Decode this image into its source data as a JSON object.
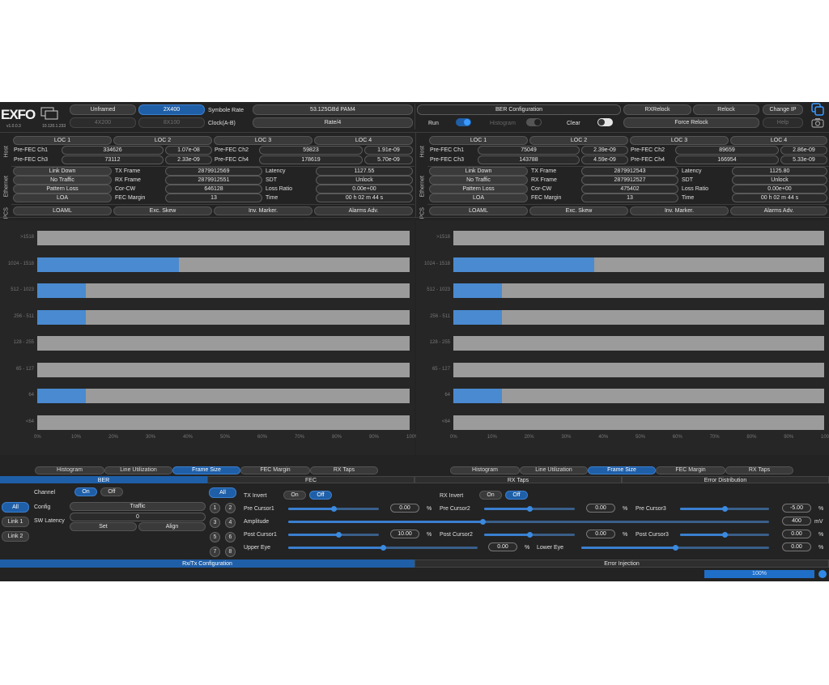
{
  "brand": {
    "logo": "EXFO",
    "version": "v1.0.0.3",
    "ip": "10.120.1.233"
  },
  "top": {
    "mode_unframed": "Unframed",
    "mode_2x400": "2X400",
    "mode_4x200": "4X200",
    "mode_8x100": "8X100",
    "symbol_rate_label": "Symbole Rate",
    "symbol_rate_value": "53.125GBd PAM4",
    "clock_label": "Clock(A-B)",
    "clock_value": "Rate/4",
    "ber_config": "BER Configuration",
    "run_label": "Run",
    "histogram_label": "Histogram",
    "clear_label": "Clear",
    "rxrelock": "RXRelock",
    "relock": "Relock",
    "force_relock": "Force Relock",
    "change_ip": "Change IP",
    "help": "Help"
  },
  "side_labels": {
    "host": "Host",
    "ethernet": "Ethernet",
    "pcs": "PCS"
  },
  "panels": [
    {
      "loc": [
        "LOC 1",
        "LOC 2",
        "LOC 3",
        "LOC 4"
      ],
      "pre_fec": {
        "ch1_label": "Pre-FEC Ch1",
        "ch1_count": "334626",
        "ch1_rate": "1.07e-08",
        "ch2_label": "Pre-FEC Ch2",
        "ch2_count": "59823",
        "ch2_rate": "1.91e-09",
        "ch3_label": "Pre-FEC Ch3",
        "ch3_count": "73112",
        "ch3_rate": "2.33e-09",
        "ch4_label": "Pre-FEC Ch4",
        "ch4_count": "178619",
        "ch4_rate": "5.70e-09"
      },
      "eth": {
        "link_down": "Link Down",
        "no_traffic": "No Traffic",
        "pattern_loss": "Pattern Loss",
        "loa": "LOA",
        "tx_frame_label": "TX Frame",
        "tx_frame": "2879912569",
        "rx_frame_label": "RX Frame",
        "rx_frame": "2879912551",
        "corcw_label": "Cor-CW",
        "corcw": "646128",
        "fec_margin_label": "FEC Margin",
        "fec_margin": "13",
        "latency_label": "Latency",
        "latency": "1127.55",
        "sdt_label": "SDT",
        "sdt": "Unlock",
        "loss_ratio_label": "Loss Ratio",
        "loss_ratio": "0.00e+00",
        "time_label": "Time",
        "time": "00 h 02 m 44 s"
      },
      "pcs": [
        "LOAML",
        "Exc. Skew",
        "Inv. Marker.",
        "Alarms Adv."
      ],
      "tabs": [
        "Histogram",
        "Line Utilization",
        "Frame Size",
        "FEC Margin",
        "RX Taps"
      ]
    },
    {
      "loc": [
        "LOC 1",
        "LOC 2",
        "LOC 3",
        "LOC 4"
      ],
      "pre_fec": {
        "ch1_label": "Pre-FEC Ch1",
        "ch1_count": "75049",
        "ch1_rate": "2.39e-09",
        "ch2_label": "Pre-FEC Ch2",
        "ch2_count": "89659",
        "ch2_rate": "2.86e-09",
        "ch3_label": "Pre-FEC Ch3",
        "ch3_count": "143788",
        "ch3_rate": "4.59e-09",
        "ch4_label": "Pre-FEC Ch4",
        "ch4_count": "166954",
        "ch4_rate": "5.33e-09"
      },
      "eth": {
        "link_down": "Link Down",
        "no_traffic": "No Traffic",
        "pattern_loss": "Pattern Loss",
        "loa": "LOA",
        "tx_frame_label": "TX Frame",
        "tx_frame": "2879912543",
        "rx_frame_label": "RX Frame",
        "rx_frame": "2879912527",
        "corcw_label": "Cor-CW",
        "corcw": "475402",
        "fec_margin_label": "FEC Margin",
        "fec_margin": "13",
        "latency_label": "Latency",
        "latency": "1125.80",
        "sdt_label": "SDT",
        "sdt": "Unlock",
        "loss_ratio_label": "Loss Ratio",
        "loss_ratio": "0.00e+00",
        "time_label": "Time",
        "time": "00 h 02 m 44 s"
      },
      "pcs": [
        "LOAML",
        "Exc. Skew",
        "Inv. Marker.",
        "Alarms Adv."
      ],
      "tabs": [
        "Histogram",
        "Line Utilization",
        "Frame Size",
        "FEC Margin",
        "RX Taps"
      ]
    }
  ],
  "chart_data": [
    {
      "type": "bar",
      "orientation": "horizontal",
      "categories": [
        ">1518",
        "1024 - 1518",
        "512 - 1023",
        "256 - 511",
        "128 - 255",
        "65 - 127",
        "64",
        "<64"
      ],
      "values": [
        0,
        38,
        13,
        13,
        0,
        0,
        13,
        0
      ],
      "xlim": [
        0,
        100
      ],
      "xticks": [
        "0%",
        "10%",
        "20%",
        "30%",
        "40%",
        "50%",
        "60%",
        "70%",
        "80%",
        "90%",
        "100%"
      ]
    },
    {
      "type": "bar",
      "orientation": "horizontal",
      "categories": [
        ">1518",
        "1024 - 1518",
        "512 - 1023",
        "256 - 511",
        "128 - 255",
        "65 - 127",
        "64",
        "<64"
      ],
      "values": [
        0,
        38,
        13,
        13,
        0,
        0,
        13,
        0
      ],
      "xlim": [
        0,
        100
      ],
      "xticks": [
        "0%",
        "10%",
        "20%",
        "30%",
        "40%",
        "50%",
        "60%",
        "70%",
        "80%",
        "90%",
        "100%"
      ]
    }
  ],
  "sections": {
    "ber": "BER",
    "fec": "FEC",
    "rx_taps": "RX Taps",
    "error_distribution": "Error Distribution"
  },
  "ber": {
    "channel_label": "Channel",
    "on": "On",
    "off": "Off",
    "all": "All",
    "link1": "Link 1",
    "link2": "Link 2",
    "config_label": "Config",
    "config_value": "Traffic",
    "sw_latency_label": "SW Latency",
    "sw_latency_value": "0",
    "set": "Set",
    "align": "Align"
  },
  "fec": {
    "all": "All",
    "lanes": [
      "1",
      "2",
      "3",
      "4",
      "5",
      "6",
      "7",
      "8"
    ],
    "tx_invert_label": "TX Invert",
    "rx_invert_label": "RX Invert",
    "on": "On",
    "off": "Off",
    "pre_cursor1_label": "Pre Cursor1",
    "pre_cursor1": "0.00",
    "pre_cursor2_label": "Pre Cursor2",
    "pre_cursor2": "0.00",
    "pre_cursor3_label": "Pre Cursor3",
    "pre_cursor3": "-5.00",
    "amplitude_label": "Amplitude",
    "amplitude": "400",
    "amplitude_unit": "mV",
    "post_cursor1_label": "Post Cursor1",
    "post_cursor1": "10.00",
    "post_cursor2_label": "Post Cursor2",
    "post_cursor2": "0.00",
    "post_cursor3_label": "Post Cursor3",
    "post_cursor3": "0.00",
    "upper_eye_label": "Upper Eye",
    "upper_eye": "0.00",
    "lower_eye_label": "Lower Eye",
    "lower_eye": "0.00",
    "pct": "%"
  },
  "bottom": {
    "rx_tx_config": "Rx/Tx Configuration",
    "error_injection": "Error Injection",
    "progress_text": "100%",
    "progress": 100
  },
  "colors": {
    "accent": "#1f5fa8",
    "bar": "#4a8ad0",
    "row_bg": "#9b9b9b",
    "bg": "#232323"
  }
}
